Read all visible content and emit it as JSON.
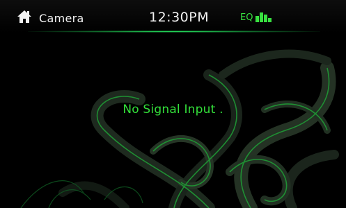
{
  "header": {
    "home_icon": "home-icon",
    "title": "Camera",
    "time": "12:30PM",
    "eq_label": "EQ",
    "eq_icon": "equalizer-icon"
  },
  "main": {
    "status_message": "No Signal Input ."
  },
  "colors": {
    "accent_green": "#33e03a",
    "text_white": "#f2f2f2",
    "background": "#000000"
  }
}
